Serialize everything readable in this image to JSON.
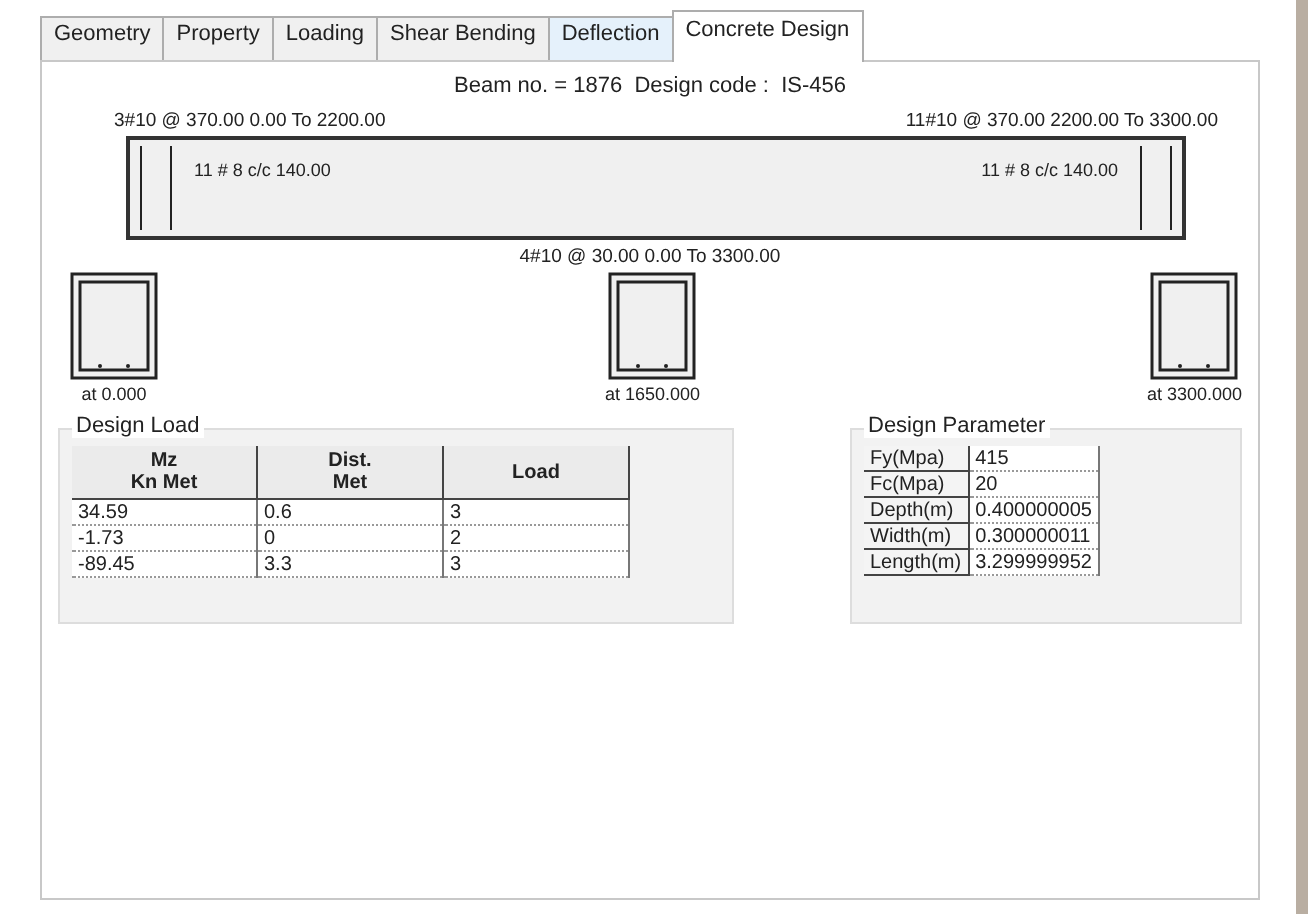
{
  "tabs": [
    {
      "label": "Geometry",
      "selected": false
    },
    {
      "label": "Property",
      "selected": false
    },
    {
      "label": "Loading",
      "selected": false
    },
    {
      "label": "Shear Bending",
      "selected": false
    },
    {
      "label": "Deflection",
      "selected": false
    },
    {
      "label": "Concrete Design",
      "selected": true
    }
  ],
  "header": "Beam no. = 1876  Design code :  IS-456",
  "beam": {
    "top_left": "3#10 @ 370.00 0.00 To 2200.00",
    "top_right": "11#10 @ 370.00 2200.00 To 3300.00",
    "stirrups_left": "11 # 8 c/c 140.00",
    "stirrups_right": "11 # 8 c/c 140.00",
    "bottom": "4#10 @ 30.00 0.00 To 3300.00"
  },
  "sections": [
    {
      "label": "at 0.000"
    },
    {
      "label": "at 1650.000"
    },
    {
      "label": "at 3300.000"
    }
  ],
  "design_load": {
    "title": "Design Load",
    "columns": [
      "Mz\nKn Met",
      "Dist.\nMet",
      "Load"
    ],
    "rows": [
      [
        "34.59",
        "0.6",
        "3"
      ],
      [
        "-1.73",
        "0",
        "2"
      ],
      [
        "-89.45",
        "3.3",
        "3"
      ]
    ]
  },
  "design_parameter": {
    "title": "Design Parameter",
    "rows": [
      [
        "Fy(Mpa)",
        "415"
      ],
      [
        "Fc(Mpa)",
        "20"
      ],
      [
        "Depth(m)",
        "0.400000005"
      ],
      [
        "Width(m)",
        "0.300000011"
      ],
      [
        "Length(m)",
        "3.299999952"
      ]
    ]
  }
}
